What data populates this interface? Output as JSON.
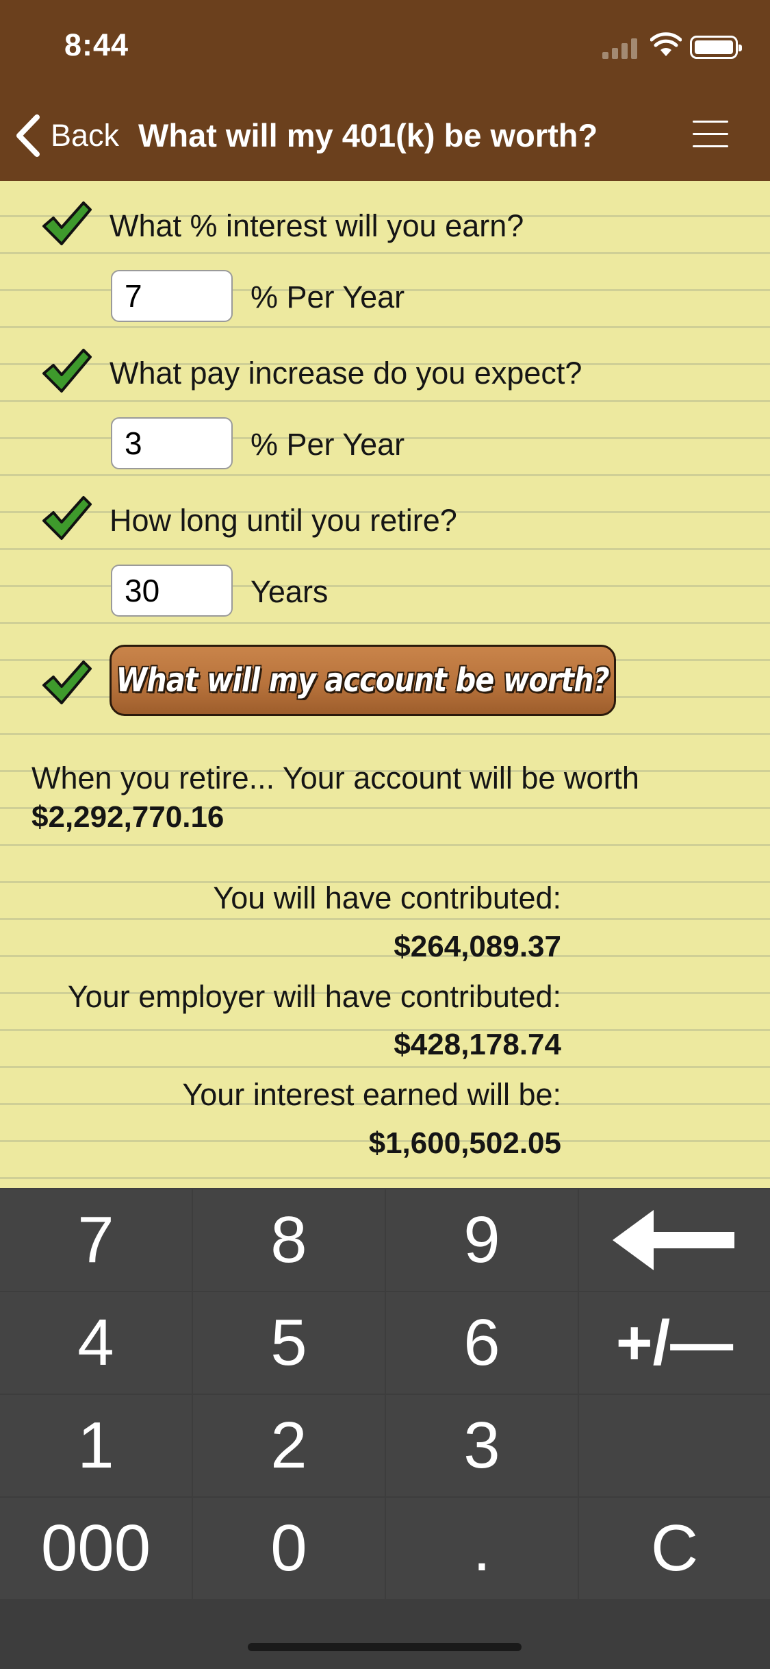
{
  "status": {
    "time": "8:44"
  },
  "nav": {
    "back_label": "Back",
    "title": "What will my 401(k) be worth?"
  },
  "form": {
    "interest": {
      "question": "What % interest will you earn?",
      "value": "7",
      "unit": "% Per Year"
    },
    "pay_increase": {
      "question": "What pay increase do you expect?",
      "value": "3",
      "unit": "% Per Year"
    },
    "years": {
      "question": "How long until you retire?",
      "value": "30",
      "unit": "Years"
    },
    "calculate_label": "What will my account be worth?"
  },
  "results": {
    "headline": "When you retire... Your account will be worth",
    "total": "$2,292,770.16",
    "you_contributed_label": "You will have contributed:",
    "you_contributed_value": "$264,089.37",
    "employer_label": "Your employer will have contributed:",
    "employer_value": "$428,178.74",
    "interest_label": "Your interest earned will be:",
    "interest_value": "$1,600,502.05"
  },
  "keypad": {
    "k7": "7",
    "k8": "8",
    "k9": "9",
    "k4": "4",
    "k5": "5",
    "k6": "6",
    "sign": "+/—",
    "k1": "1",
    "k2": "2",
    "k3": "3",
    "k000": "000",
    "k0": "0",
    "dot": ".",
    "clear": "C"
  },
  "icons": {
    "backspace": "backspace-arrow-icon",
    "check": "check-icon",
    "back": "chevron-left-icon",
    "menu": "hamburger-menu-icon"
  },
  "colors": {
    "nav": "#6b401d",
    "paper": "#ede99f",
    "keypad": "#444444",
    "check": "#3e9a2c"
  }
}
